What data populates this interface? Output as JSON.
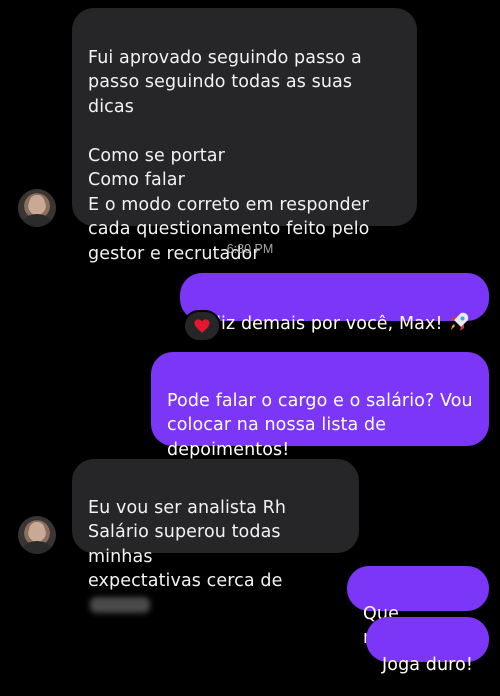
{
  "messages": {
    "m1": "Fui aprovado seguindo passo a\npasso seguindo todas as suas dicas\n\nComo se portar\nComo falar\nE o modo correto em responder\ncada questionamento feito pelo\ngestor e recrutador",
    "timestamp": "6:30 PM",
    "m2": "Feliz demais por você, Max!",
    "m2_emoji": "rocket",
    "m2_reaction": "heart",
    "m3": "Pode falar o cargo e o salário? Vou\ncolocar na nossa lista de\ndepoimentos!",
    "m4": "Eu vou ser analista Rh\nSalário superou todas minhas\nexpectativas cerca de",
    "m5": "Que massa!!!",
    "m6": "Joga duro!"
  },
  "colors": {
    "background": "#000000",
    "incoming_bubble": "#262628",
    "outgoing_bubble": "#7b36f8",
    "timestamp_text": "#a4a4a8"
  },
  "icons": [
    "avatar",
    "rocket-emoji-icon",
    "heart-reaction-icon"
  ]
}
